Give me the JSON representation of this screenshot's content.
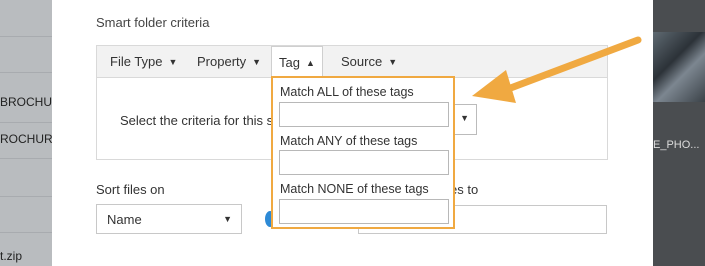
{
  "background": {
    "left_items": [
      "BROCHU",
      "ROCHUR",
      "t.zip"
    ],
    "right_item": "E_PHO..."
  },
  "dialog": {
    "section_title": "Smart folder criteria",
    "tabs": [
      {
        "label": "File Type",
        "active": false
      },
      {
        "label": "Property",
        "active": false
      },
      {
        "label": "Tag",
        "active": true
      },
      {
        "label": "Source",
        "active": false
      }
    ],
    "hint": "Select the criteria for this sm",
    "sort_label": "Sort files on",
    "sort_value": "Name",
    "right_label": "es to"
  },
  "tag_popup": {
    "all_label": "Match ALL of these tags",
    "all_value": "",
    "any_label": "Match ANY of these tags",
    "any_value": "",
    "none_label": "Match NONE of these tags",
    "none_value": ""
  },
  "colors": {
    "highlight": "#f0a941",
    "accent": "#2d8ad6"
  }
}
